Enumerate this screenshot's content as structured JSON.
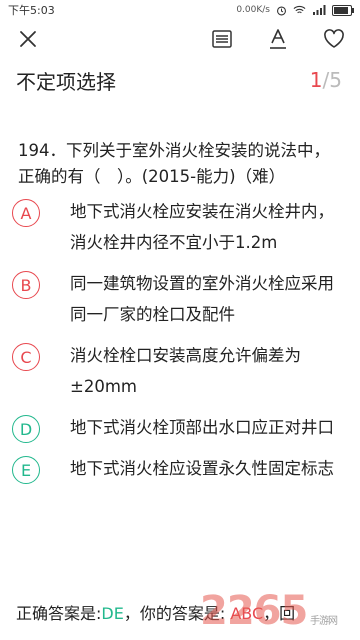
{
  "statusbar": {
    "time": "下午5:03",
    "network_speed": "0.00K/s",
    "battery_level": 0.9
  },
  "toolbar": {
    "close_icon": "close-icon",
    "list_icon": "list-icon",
    "font_icon": "font-size-icon",
    "favorite_icon": "heart-icon"
  },
  "header": {
    "title": "不定项选择",
    "current": "1",
    "total": "/5"
  },
  "question": {
    "text": "194．下列关于室外消火栓安装的说法中，正确的有（　）。(2015-能力)（难）"
  },
  "options": [
    {
      "letter": "A",
      "text": "地下式消火栓应安装在消火栓井内，消火栓井内径不宜小于1.2m",
      "color": "#e8484f"
    },
    {
      "letter": "B",
      "text": "同一建筑物设置的室外消火栓应采用同一厂家的栓口及配件",
      "color": "#e8484f"
    },
    {
      "letter": "C",
      "text": "消火栓栓口安装高度允许偏差为±20mm",
      "color": "#e8484f"
    },
    {
      "letter": "D",
      "text": "地下式消火栓顶部出水口应正对井口",
      "color": "#22b88d"
    },
    {
      "letter": "E",
      "text": "地下式消火栓应设置永久性固定标志",
      "color": "#22b88d"
    }
  ],
  "answer": {
    "correct_label": "正确答案是:",
    "correct_value": "DE",
    "user_label": "，你的答案是: ",
    "user_value": "ABC",
    "tail": "，回"
  },
  "watermark": {
    "brand": "2265",
    "sub": "手游网"
  },
  "colors": {
    "accent_red": "#e8484f",
    "accent_green": "#22b88d"
  }
}
